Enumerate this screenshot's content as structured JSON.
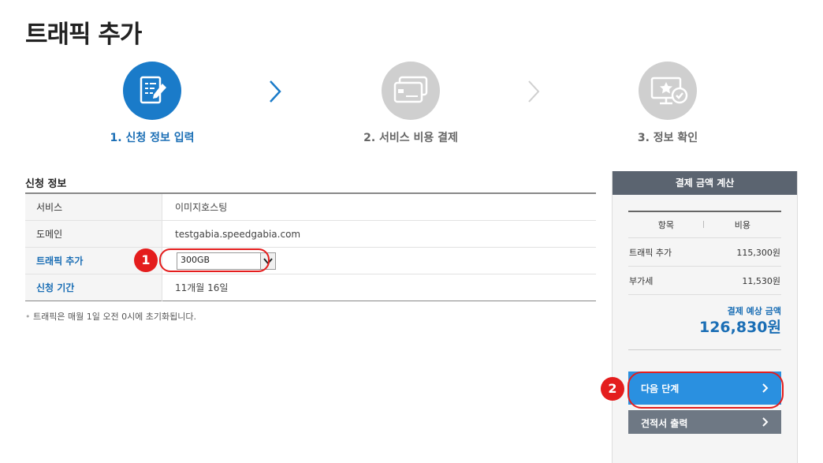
{
  "page": {
    "title": "트래픽 추가"
  },
  "steps": [
    {
      "label": "1. 신청 정보 입력",
      "active": true
    },
    {
      "label": "2. 서비스 비용 결제",
      "active": false
    },
    {
      "label": "3. 정보 확인",
      "active": false
    }
  ],
  "form": {
    "section_title": "신청 정보",
    "rows": {
      "service": {
        "label": "서비스",
        "value": "이미지호스팅"
      },
      "domain": {
        "label": "도메인",
        "value": "testgabia.speedgabia.com"
      },
      "traffic": {
        "label": "트래픽 추가",
        "selected": "300GB"
      },
      "period": {
        "label": "신청 기간",
        "value": "11개월 16일"
      }
    },
    "note": "트래픽은 매월 1일 오전 0시에 초기화됩니다."
  },
  "annotations": {
    "badge1": "1",
    "badge2": "2"
  },
  "payment": {
    "header": "결제 금액 계산",
    "col_item": "항목",
    "col_cost": "비용",
    "items": [
      {
        "name": "트래픽 추가",
        "cost": "115,300원"
      },
      {
        "name": "부가세",
        "cost": "11,530원"
      }
    ],
    "total_label": "결제 예상 금액",
    "total_value": "126,830원",
    "next_button": "다음 단계",
    "print_button": "견적서 출력"
  },
  "colors": {
    "accent": "#1a7bc9",
    "annotation": "#e41d1d",
    "inactive": "#cfcfcf",
    "panel_header": "#5b6470"
  }
}
